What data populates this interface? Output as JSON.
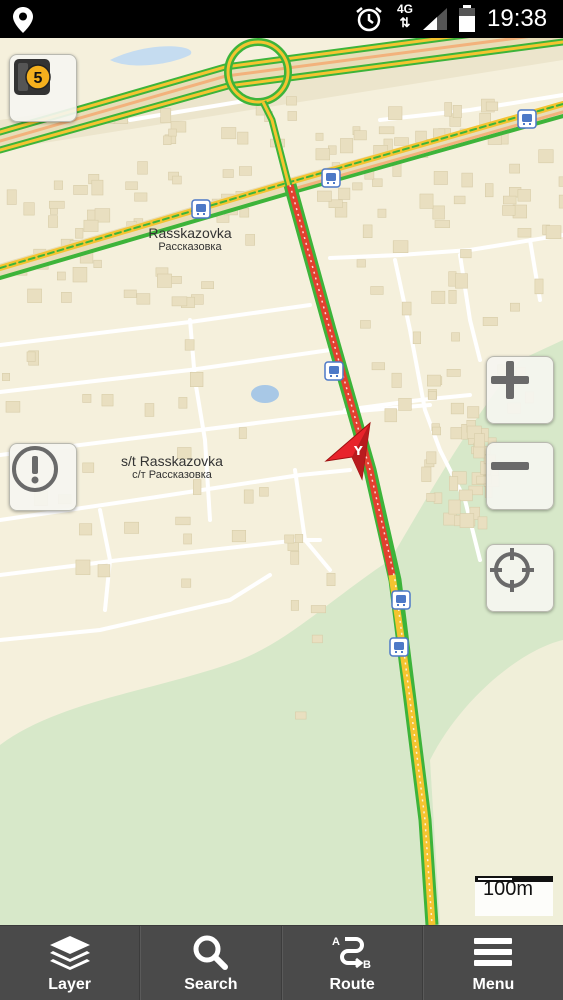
{
  "status_bar": {
    "network": "4G",
    "time": "19:38"
  },
  "map": {
    "traffic_level": "5",
    "labels": [
      {
        "main": "Rasskazovka",
        "sub": "Рассказовка"
      },
      {
        "main": "s/t Rasskazovka",
        "sub": "с/т Рассказовка"
      }
    ],
    "scale": "100m",
    "colors": {
      "background": "#f5f0dc",
      "forest": "#d7e8c9",
      "traffic_heavy": "#e2402f",
      "traffic_medium": "#f4c430",
      "traffic_free": "#3db43a",
      "user_arrow": "#e8232b"
    }
  },
  "bottom_bar": {
    "items": [
      {
        "label": "Layer",
        "icon": "layers-icon"
      },
      {
        "label": "Search",
        "icon": "search-icon"
      },
      {
        "label": "Route",
        "icon": "route-icon"
      },
      {
        "label": "Menu",
        "icon": "menu-icon"
      }
    ]
  }
}
